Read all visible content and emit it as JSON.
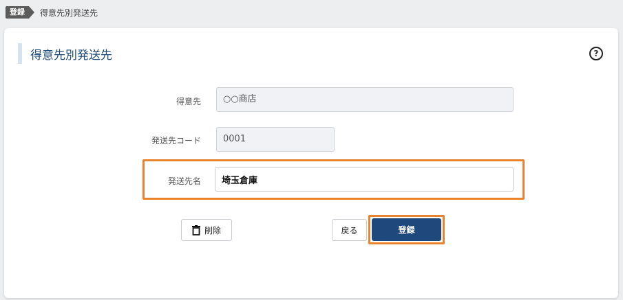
{
  "breadcrumb": {
    "tag": "登録",
    "current": "得意先別発送先"
  },
  "page": {
    "title": "得意先別発送先",
    "help_icon": "?"
  },
  "form": {
    "customer": {
      "label": "得意先",
      "value": "○○商店"
    },
    "ship_code": {
      "label": "発送先コード",
      "value": "0001"
    },
    "ship_name": {
      "label": "発送先名",
      "value": "埼玉倉庫"
    }
  },
  "buttons": {
    "delete": "削除",
    "back": "戻る",
    "register": "登録"
  },
  "colors": {
    "highlight": "#e8832f",
    "primary": "#1f497d",
    "title": "#1e4b78"
  }
}
